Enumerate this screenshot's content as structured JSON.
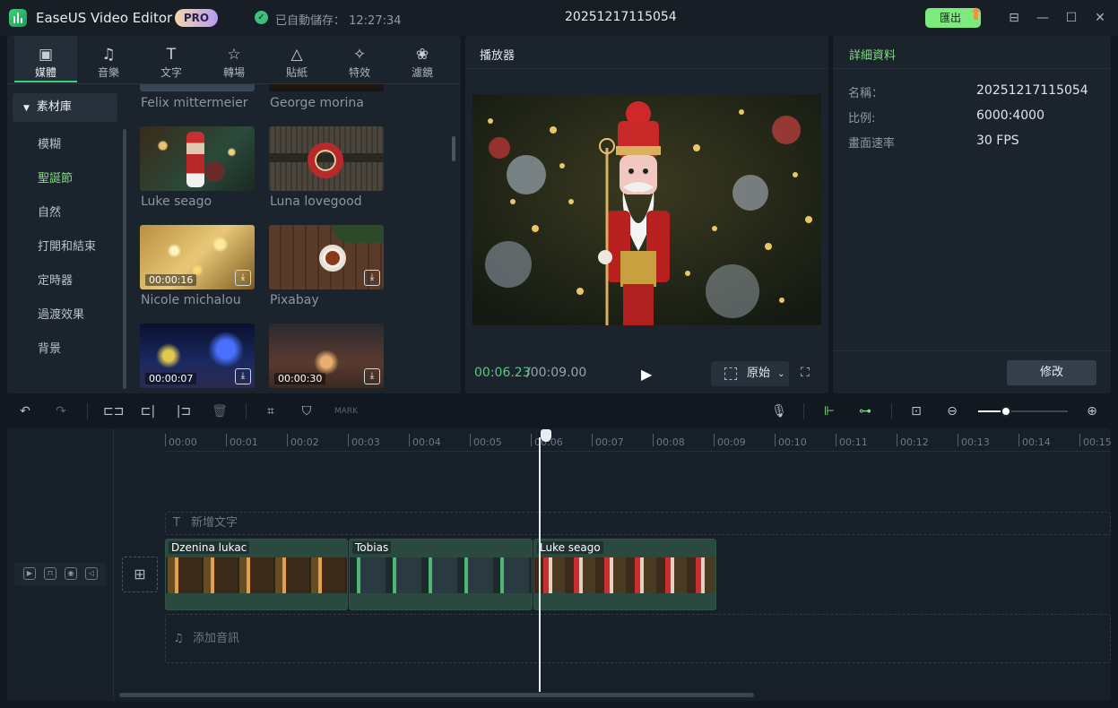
{
  "app": {
    "name": "EaseUS Video Editor",
    "badge": "PRO",
    "autosave": "已自動儲存： 12:27:34",
    "project": "20251217115054",
    "export_label": "匯出"
  },
  "media": {
    "tabs": [
      {
        "label": "媒體",
        "icon": "media-icon"
      },
      {
        "label": "音樂",
        "icon": "music-icon"
      },
      {
        "label": "文字",
        "icon": "text-icon"
      },
      {
        "label": "轉場",
        "icon": "transition-icon"
      },
      {
        "label": "貼紙",
        "icon": "sticker-icon"
      },
      {
        "label": "特效",
        "icon": "effects-icon"
      },
      {
        "label": "濾鏡",
        "icon": "filter-icon"
      }
    ],
    "library_label": "素材庫",
    "categories": [
      "模糊",
      "聖誕節",
      "自然",
      "打開和結束",
      "定時器",
      "過渡效果",
      "背景"
    ],
    "items": [
      {
        "name": "Felix mittermeier",
        "duration": ""
      },
      {
        "name": "George morina",
        "duration": ""
      },
      {
        "name": "Luke seago",
        "duration": ""
      },
      {
        "name": "Luna lovegood",
        "duration": ""
      },
      {
        "name": "Nicole michalou",
        "duration": "00:00:16"
      },
      {
        "name": "Pixabay",
        "duration": ""
      },
      {
        "name": "",
        "duration": "00:00:07"
      },
      {
        "name": "",
        "duration": "00:00:30"
      }
    ]
  },
  "player": {
    "title": "播放器",
    "current": "00:06.23",
    "total": "/00:09.00",
    "ratio_label": "原始"
  },
  "details": {
    "title": "詳細資料",
    "rows": [
      {
        "key": "名稱：",
        "value": "20251217115054"
      },
      {
        "key": "比例:",
        "value": "6000:4000"
      },
      {
        "key": "畫面速率",
        "value": "30 FPS"
      }
    ],
    "edit_label": "修改"
  },
  "timeline": {
    "ticks": [
      "00:00",
      "00:01",
      "00:02",
      "00:03",
      "00:04",
      "00:05",
      "00:06",
      "00:07",
      "00:08",
      "00:09",
      "00:10",
      "00:11",
      "00:12",
      "00:13",
      "00:14",
      "00:15"
    ],
    "text_track": "新增文字",
    "audio_track": "添加音訊",
    "clips": [
      {
        "name": "Dzenina lukac"
      },
      {
        "name": "Tobias"
      },
      {
        "name": "Luke seago"
      }
    ]
  }
}
